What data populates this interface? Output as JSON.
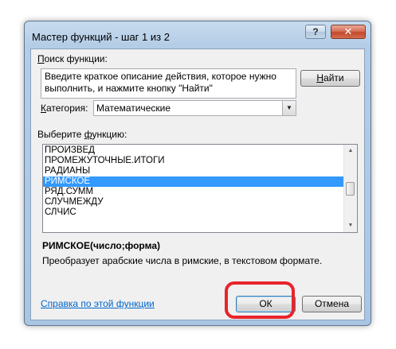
{
  "window": {
    "title": "Мастер функций - шаг 1 из 2",
    "help_label": "?",
    "close_label": "✕"
  },
  "search": {
    "label_underlined": "П",
    "label_rest": "оиск функции:",
    "description": "Введите краткое описание действия, которое нужно выполнить, и нажмите кнопку \"Найти\"",
    "find_button_underlined": "Н",
    "find_button_rest": "айти"
  },
  "category": {
    "label_underlined": "К",
    "label_rest": "атегория:",
    "value": "Математические",
    "arrow": "▼"
  },
  "function_list": {
    "label_before": "Выберите ",
    "label_underlined": "ф",
    "label_after": "ункцию:",
    "items": [
      "ПРОИЗВЕД",
      "ПРОМЕЖУТОЧНЫЕ.ИТОГИ",
      "РАДИАНЫ",
      "РИМСКОЕ",
      "РЯД.СУММ",
      "СЛУЧМЕЖДУ",
      "СЛЧИС"
    ],
    "selected_index": 3,
    "scroll_up": "▲",
    "scroll_down": "▼"
  },
  "selected_function": {
    "signature": "РИМСКОЕ(число;форма)",
    "description": "Преобразует арабские числа в римские, в текстовом формате."
  },
  "footer": {
    "help_link": "Справка по этой функции",
    "ok_label": "ОК",
    "cancel_label": "Отмена"
  },
  "colors": {
    "selection": "#3399ff",
    "highlight_ring": "#e8242a",
    "link": "#0066cc"
  }
}
